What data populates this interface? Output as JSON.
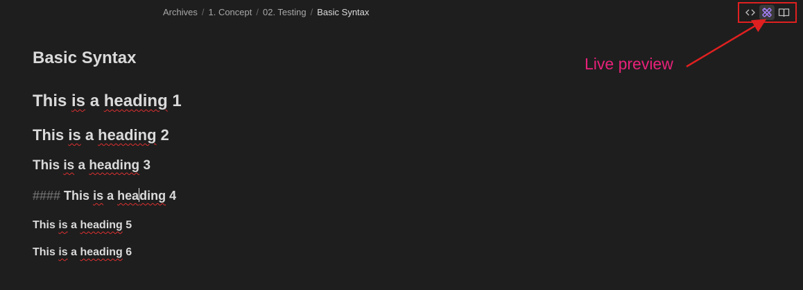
{
  "breadcrumb": {
    "items": [
      "Archives",
      "1. Concept",
      "02. Testing",
      "Basic Syntax"
    ],
    "separator": "/"
  },
  "view_modes": [
    {
      "name": "source-mode",
      "icon": "code-brackets-icon",
      "active": false
    },
    {
      "name": "live-preview",
      "icon": "pencil-ruler-icon",
      "active": true
    },
    {
      "name": "reading-mode",
      "icon": "book-open-icon",
      "active": false
    }
  ],
  "document": {
    "title": "Basic Syntax",
    "headings": {
      "h1": {
        "a": "This ",
        "b": "is",
        "c": " a ",
        "d": "heading",
        "e": " 1"
      },
      "h2": {
        "a": "This ",
        "b": "is",
        "c": " a ",
        "d": "heading",
        "e": " 2"
      },
      "h3": {
        "a": "This ",
        "b": "is",
        "c": " a ",
        "d": "heading",
        "e": " 3"
      },
      "h4": {
        "marker": "####",
        "a": "This ",
        "b": "is",
        "c": " a ",
        "d1": "hea",
        "d2": "ding",
        "e": " 4"
      },
      "h5": {
        "a": "This ",
        "b": "is",
        "c": " a ",
        "d": "heading",
        "e": " 5"
      },
      "h6": {
        "a": "This ",
        "b": "is",
        "c": " a ",
        "d": "heading",
        "e": " 6"
      }
    }
  },
  "annotation": {
    "text": "Live preview",
    "color": "#e8217a",
    "arrow_color": "#e02020"
  },
  "colors": {
    "background": "#1e1e1e",
    "text": "#dadada",
    "muted": "#a8a8a8",
    "accent": "#a882ff",
    "highlight_box": "#e02020",
    "spellcheck": "#e03030"
  }
}
